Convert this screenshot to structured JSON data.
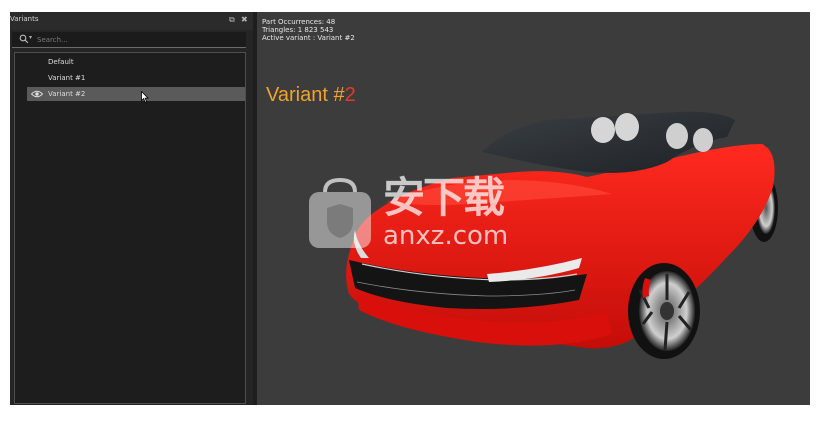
{
  "panel": {
    "title": "Variants",
    "popout_glyph": "⧉",
    "close_glyph": "✖",
    "search_placeholder": "Search...",
    "items": [
      {
        "label": "Default",
        "selected": false
      },
      {
        "label": "Variant #1",
        "selected": false
      },
      {
        "label": "Variant #2",
        "selected": true
      }
    ]
  },
  "viewport": {
    "stats": {
      "part_occurrences": "Part Occurrences: 48",
      "triangles": "Triangles: 1 823 543",
      "active_variant": "Active variant : Variant #2"
    },
    "overlay_prefix": "Variant #",
    "overlay_number": "2",
    "watermark_cn": "安下载",
    "watermark_url": "anxz.com"
  },
  "colors": {
    "accent_orange": "#f0a32a",
    "accent_red": "#e33a2a",
    "car_body": "#e8140f"
  }
}
